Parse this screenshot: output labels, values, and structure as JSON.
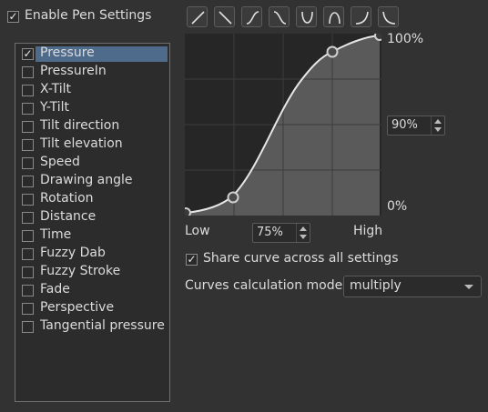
{
  "header": {
    "enable_label": "Enable Pen Settings",
    "enable_checked": true
  },
  "sensors": [
    {
      "label": "Pressure",
      "checked": true,
      "selected": true
    },
    {
      "label": "PressureIn",
      "checked": false
    },
    {
      "label": "X-Tilt",
      "checked": false
    },
    {
      "label": "Y-Tilt",
      "checked": false
    },
    {
      "label": "Tilt direction",
      "checked": false
    },
    {
      "label": "Tilt elevation",
      "checked": false
    },
    {
      "label": "Speed",
      "checked": false
    },
    {
      "label": "Drawing angle",
      "checked": false
    },
    {
      "label": "Rotation",
      "checked": false
    },
    {
      "label": "Distance",
      "checked": false
    },
    {
      "label": "Time",
      "checked": false
    },
    {
      "label": "Fuzzy Dab",
      "checked": false
    },
    {
      "label": "Fuzzy Stroke",
      "checked": false
    },
    {
      "label": "Fade",
      "checked": false
    },
    {
      "label": "Perspective",
      "checked": false
    },
    {
      "label": "Tangential pressure",
      "checked": false
    }
  ],
  "curve_presets": [
    "linear-curve-icon",
    "reverse-linear-curve-icon",
    "s-curve-icon",
    "reverse-s-curve-icon",
    "convex-curve-icon",
    "concave-curve-icon",
    "j-curve-icon",
    "reverse-j-curve-icon"
  ],
  "curve_editor": {
    "y_max_label": "100%",
    "y_min_label": "0%",
    "x_min_label": "Low",
    "x_max_label": "High",
    "y_spin_value": "90%",
    "x_spin_value": "75%"
  },
  "share_curve": {
    "label": "Share curve across all settings",
    "checked": true
  },
  "mode": {
    "label": "Curves calculation mode:",
    "value": "multiply"
  },
  "colors": {
    "selection": "#4f6b8c",
    "background": "#323232",
    "curve_fill": "#5a5a5a"
  }
}
